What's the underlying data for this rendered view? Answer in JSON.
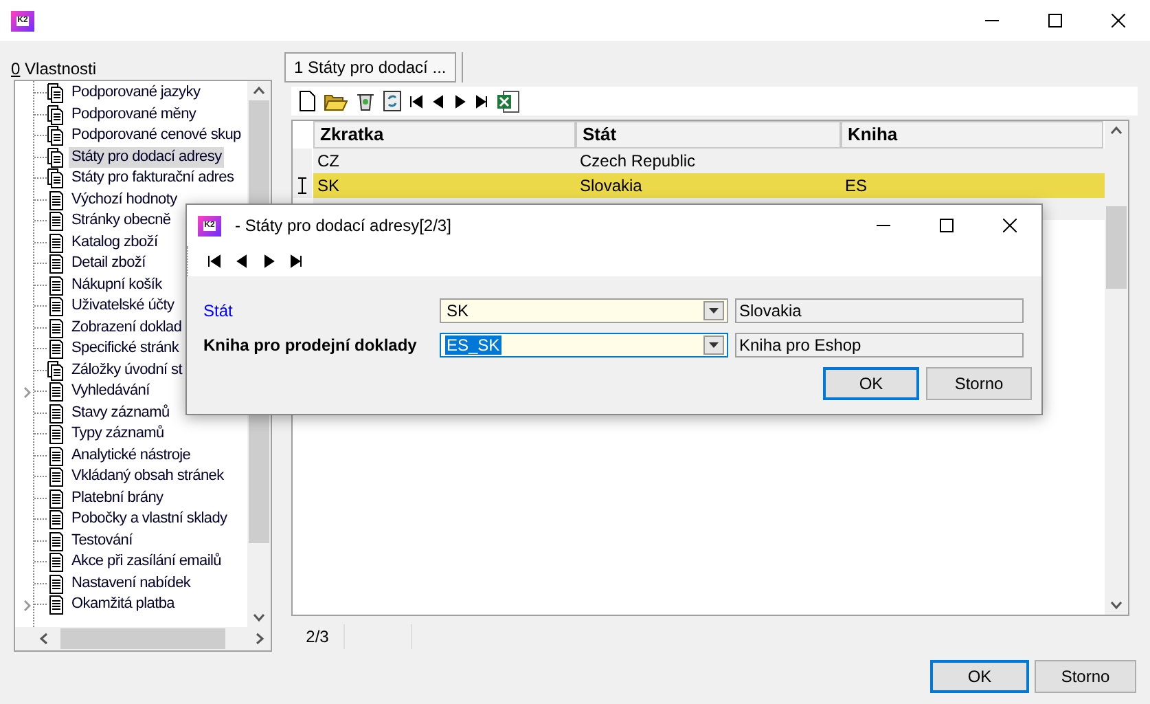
{
  "window": {
    "logo": "K2"
  },
  "tree": {
    "hotkey": "0",
    "label": "Vlastnosti",
    "items": [
      {
        "label": "Podporované jazyky",
        "kind": "stacked",
        "expandable": false,
        "selected": false
      },
      {
        "label": "Podporované měny",
        "kind": "stacked",
        "expandable": false,
        "selected": false
      },
      {
        "label": "Podporované cenové skup",
        "kind": "stacked",
        "expandable": false,
        "selected": false
      },
      {
        "label": "Státy pro dodací adresy",
        "kind": "stacked",
        "expandable": false,
        "selected": true
      },
      {
        "label": "Státy pro fakturační adres",
        "kind": "stacked",
        "expandable": false,
        "selected": false
      },
      {
        "label": "Výchozí hodnoty",
        "kind": "single",
        "expandable": false,
        "selected": false
      },
      {
        "label": "Stránky obecně",
        "kind": "single",
        "expandable": false,
        "selected": false
      },
      {
        "label": "Katalog zboží",
        "kind": "single",
        "expandable": false,
        "selected": false
      },
      {
        "label": "Detail zboží",
        "kind": "single",
        "expandable": false,
        "selected": false
      },
      {
        "label": "Nákupní košík",
        "kind": "single",
        "expandable": false,
        "selected": false
      },
      {
        "label": "Uživatelské účty",
        "kind": "single",
        "expandable": false,
        "selected": false
      },
      {
        "label": "Zobrazení doklad",
        "kind": "single",
        "expandable": false,
        "selected": false
      },
      {
        "label": "Specifické stránk",
        "kind": "single",
        "expandable": false,
        "selected": false
      },
      {
        "label": "Záložky úvodní st",
        "kind": "stacked",
        "expandable": false,
        "selected": false
      },
      {
        "label": "Vyhledávání",
        "kind": "single",
        "expandable": true,
        "selected": false
      },
      {
        "label": "Stavy záznamů",
        "kind": "single",
        "expandable": false,
        "selected": false
      },
      {
        "label": "Typy záznamů",
        "kind": "single",
        "expandable": false,
        "selected": false
      },
      {
        "label": "Analytické nástroje",
        "kind": "single",
        "expandable": false,
        "selected": false
      },
      {
        "label": "Vkládaný obsah stránek",
        "kind": "single",
        "expandable": false,
        "selected": false
      },
      {
        "label": "Platební brány",
        "kind": "single",
        "expandable": false,
        "selected": false
      },
      {
        "label": "Pobočky a vlastní sklady",
        "kind": "single",
        "expandable": false,
        "selected": false
      },
      {
        "label": "Testování",
        "kind": "single",
        "expandable": false,
        "selected": false
      },
      {
        "label": "Akce při zasílání emailů",
        "kind": "single",
        "expandable": false,
        "selected": false
      },
      {
        "label": "Nastavení nabídek",
        "kind": "single",
        "expandable": false,
        "selected": false
      },
      {
        "label": "Okamžitá platba",
        "kind": "single",
        "expandable": true,
        "selected": false
      }
    ]
  },
  "tabs": [
    {
      "label": "1 Státy pro dodací ...",
      "selected": true
    }
  ],
  "grid": {
    "columns": [
      "Zkratka",
      "Stát",
      "Kniha"
    ],
    "rows": [
      {
        "cells": [
          "CZ",
          "Czech Republic",
          ""
        ],
        "selected": false
      },
      {
        "cells": [
          "SK",
          "Slovakia",
          "ES"
        ],
        "selected": true
      }
    ]
  },
  "status_bar": [
    "2/3"
  ],
  "buttons": [
    {
      "label": "OK",
      "default": true
    },
    {
      "label": "Storno",
      "default": false
    }
  ],
  "dialog": {
    "logo": "K2",
    "title": "- Státy pro dodací adresy[2/3]",
    "fields": [
      {
        "label": "Stát",
        "kind": "link",
        "value": "SK",
        "value_selected": false,
        "description": "Slovakia"
      },
      {
        "label": "Kniha pro prodejní doklady",
        "kind": "bold",
        "value": "ES_SK",
        "value_selected": true,
        "description": "Kniha pro Eshop"
      }
    ],
    "buttons": [
      {
        "label": "OK",
        "default": true
      },
      {
        "label": "Storno",
        "default": false
      }
    ]
  }
}
